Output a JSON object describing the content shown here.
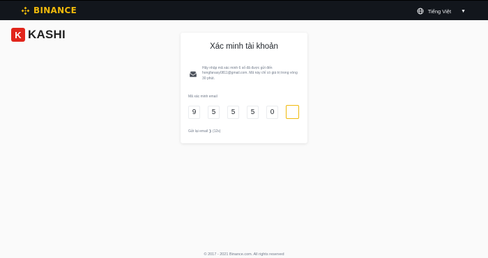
{
  "header": {
    "brand_name": "BINANCE",
    "brand_color": "#f0b90b",
    "language": "Tiếng Việt",
    "language_icon": "globe-icon",
    "dropdown_icon": "caret-down-icon"
  },
  "watermark": {
    "badge_letter": "K",
    "text": "KASHI",
    "badge_color": "#e1251b"
  },
  "verify": {
    "title": "Xác minh tài khoản",
    "info_icon": "email-icon",
    "info_text": "Hãy nhập mã xác minh 6 số đã được gửi đến hongfanasy0811@gmail.com. Mã này chỉ có giá trị trong vòng 30 phút.",
    "code_label": "Mã xác minh email",
    "digits": [
      "9",
      "5",
      "5",
      "5",
      "0",
      ""
    ],
    "resend": "Gửi lại email ❯ (12s)",
    "accent_color": "#f0b90b"
  },
  "footer": {
    "copyright": "© 2017 - 2021 Binance.com. All rights reserved"
  }
}
